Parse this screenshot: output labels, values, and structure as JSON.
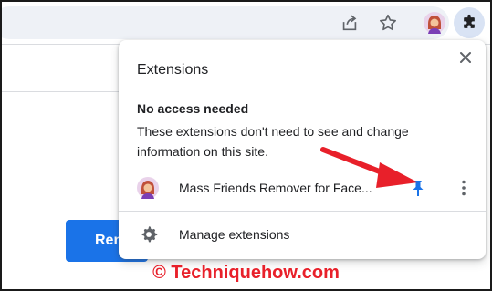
{
  "toolbar": {
    "icons": [
      "share-icon",
      "bookmark-star-icon",
      "profile-avatar-icon",
      "extensions-puzzle-icon"
    ]
  },
  "page": {
    "button_label": "Ren"
  },
  "popup": {
    "title": "Extensions",
    "section_heading": "No access needed",
    "section_description": "These extensions don't need to see and change information on this site.",
    "extension": {
      "name": "Mass Friends Remover for Face...",
      "pinned": true
    },
    "manage_label": "Manage extensions"
  },
  "watermark": "© Techniquehow.com",
  "colors": {
    "accent": "#1a73e8",
    "annotation": "#e8202a",
    "text": "#202124",
    "divider": "#dadce0"
  }
}
